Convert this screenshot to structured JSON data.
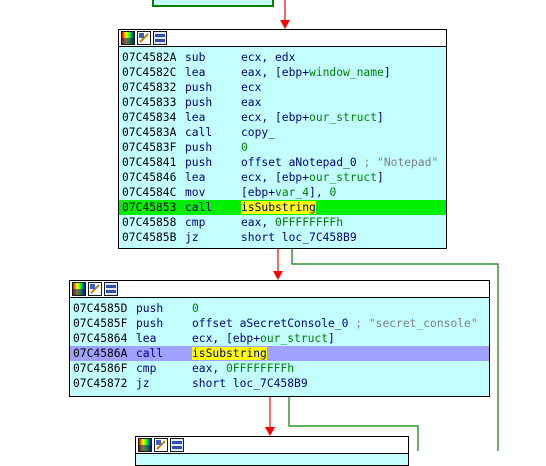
{
  "blocks": [
    {
      "rows": [
        {
          "addr": "07C4582A",
          "mn": "sub",
          "op": [
            {
              "t": "ecx, edx"
            }
          ]
        },
        {
          "addr": "07C4582C",
          "mn": "lea",
          "op": [
            {
              "t": "eax, [ebp+"
            },
            {
              "t": "window_name",
              "c": "g"
            },
            {
              "t": "]"
            }
          ]
        },
        {
          "addr": "07C45832",
          "mn": "push",
          "op": [
            {
              "t": "ecx"
            }
          ]
        },
        {
          "addr": "07C45833",
          "mn": "push",
          "op": [
            {
              "t": "eax"
            }
          ]
        },
        {
          "addr": "07C45834",
          "mn": "lea",
          "op": [
            {
              "t": "ecx, [ebp+"
            },
            {
              "t": "our_struct",
              "c": "g"
            },
            {
              "t": "]"
            }
          ]
        },
        {
          "addr": "07C4583A",
          "mn": "call",
          "op": [
            {
              "t": "copy_"
            }
          ]
        },
        {
          "addr": "07C4583F",
          "mn": "push",
          "op": [
            {
              "t": "0",
              "c": "g"
            }
          ]
        },
        {
          "addr": "07C45841",
          "mn": "push",
          "op": [
            {
              "t": "offset aNotepad_0 "
            },
            {
              "t": "; \"Notepad\"",
              "c": "cm"
            }
          ]
        },
        {
          "addr": "07C45846",
          "mn": "lea",
          "op": [
            {
              "t": "ecx, [ebp+"
            },
            {
              "t": "our_struct",
              "c": "g"
            },
            {
              "t": "]"
            }
          ]
        },
        {
          "addr": "07C4584C",
          "mn": "mov",
          "op": [
            {
              "t": "[ebp+"
            },
            {
              "t": "var_4",
              "c": "g"
            },
            {
              "t": "], "
            },
            {
              "t": "0",
              "c": "g"
            }
          ]
        },
        {
          "addr": "07C45853",
          "mn": "call",
          "op": [
            {
              "t": "isSubstring",
              "c": "yl"
            }
          ],
          "hl": "green"
        },
        {
          "addr": "07C45858",
          "mn": "cmp",
          "op": [
            {
              "t": "eax, "
            },
            {
              "t": "0FFFFFFFFh",
              "c": "g"
            }
          ]
        },
        {
          "addr": "07C4585B",
          "mn": "jz",
          "op": [
            {
              "t": "short loc_7C458B9"
            }
          ]
        }
      ]
    },
    {
      "rows": [
        {
          "addr": "07C4585D",
          "mn": "push",
          "op": [
            {
              "t": "0",
              "c": "g"
            }
          ]
        },
        {
          "addr": "07C4585F",
          "mn": "push",
          "op": [
            {
              "t": "offset aSecretConsole_0 "
            },
            {
              "t": "; \"secret_console\"",
              "c": "cm"
            }
          ]
        },
        {
          "addr": "07C45864",
          "mn": "lea",
          "op": [
            {
              "t": "ecx, [ebp+"
            },
            {
              "t": "our_struct",
              "c": "g"
            },
            {
              "t": "]"
            }
          ]
        },
        {
          "addr": "07C4586A",
          "mn": "call",
          "op": [
            {
              "t": "isSubstring",
              "c": "yl"
            }
          ],
          "hl": "purple"
        },
        {
          "addr": "07C4586F",
          "mn": "cmp",
          "op": [
            {
              "t": "eax, "
            },
            {
              "t": "0FFFFFFFFh",
              "c": "g"
            }
          ]
        },
        {
          "addr": "07C45872",
          "mn": "jz",
          "op": [
            {
              "t": "short loc_7C458B9"
            }
          ]
        }
      ]
    },
    {
      "rows": []
    }
  ],
  "colors": {
    "block_bg": "#c4ffff",
    "edge_true": "#008000",
    "edge_false": "#ff0000",
    "current_line": "#00ee00",
    "selected_line": "#a0a0ff",
    "highlight": "#ffff00",
    "operand_green": "#008000",
    "comment": "#808080"
  },
  "header_icons": [
    "palette-icon",
    "edit-block-icon",
    "graph-overview-icon"
  ]
}
